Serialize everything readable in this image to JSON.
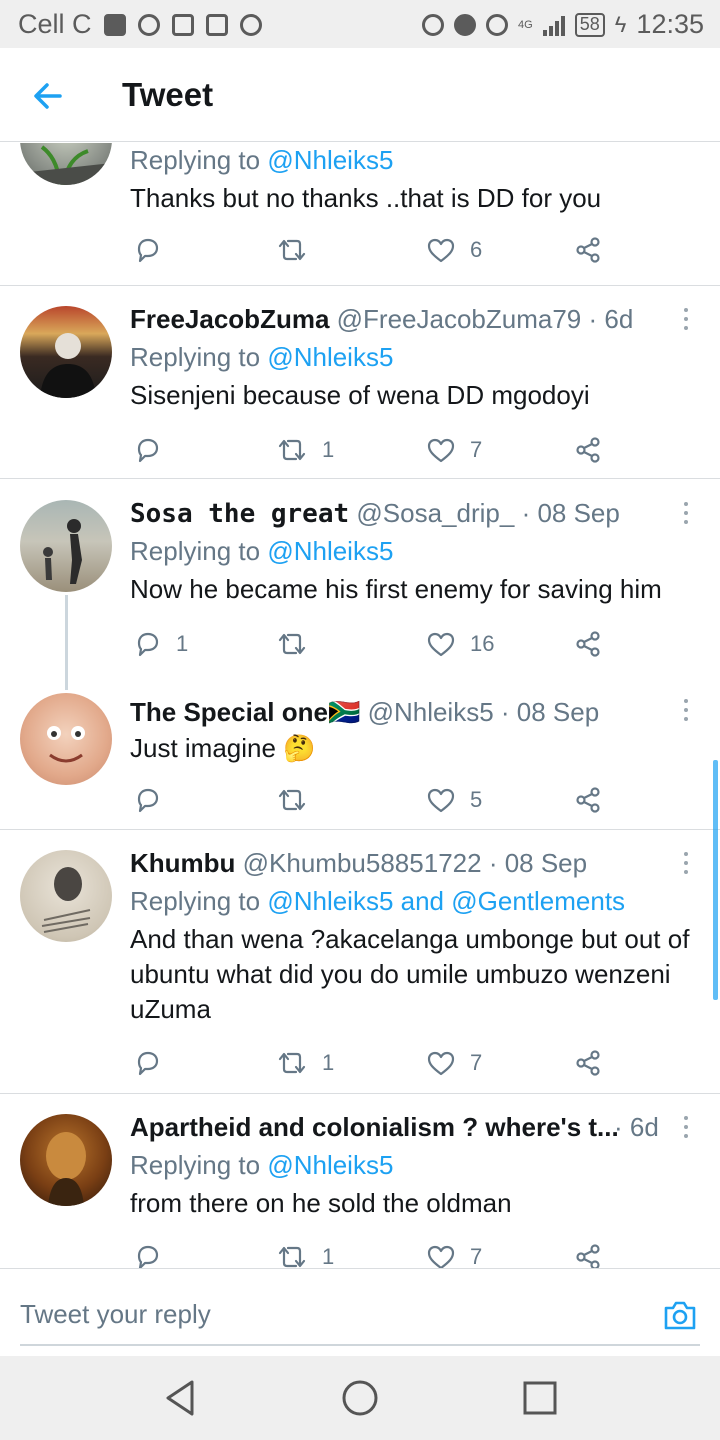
{
  "status_bar": {
    "carrier": "Cell C",
    "network": "4G",
    "battery": "58",
    "time": "12:35"
  },
  "header": {
    "title": "Tweet",
    "back_icon": "arrow-left-icon"
  },
  "colors": {
    "accent": "#1da1f2",
    "secondary_text": "#657786",
    "divider": "#dadde0"
  },
  "tweets": [
    {
      "name": "",
      "handle": "",
      "time": "",
      "reply_prefix": "Replying to ",
      "reply_to": "@Nhleiks5",
      "text": "Thanks but no thanks ..that is DD for you",
      "replies": "",
      "retweets": "",
      "likes": "6"
    },
    {
      "name": "FreeJacobZuma",
      "handle": "@FreeJacobZuma79",
      "time": "· 6d",
      "reply_prefix": "Replying to ",
      "reply_to": "@Nhleiks5",
      "text": "Sisenjeni because of wena DD mgodoyi",
      "replies": "",
      "retweets": "1",
      "likes": "7"
    },
    {
      "name": "Sosa the great",
      "handle": "@Sosa_drip_",
      "time": "· 08 Sep",
      "reply_prefix": "Replying to ",
      "reply_to": "@Nhleiks5",
      "text": "Now he became his first enemy for saving him",
      "replies": "1",
      "retweets": "",
      "likes": "16"
    },
    {
      "name": "The Special one🇿🇦",
      "handle": "@Nhleiks5",
      "time": "· 08 Sep",
      "text": "Just imagine 🤔",
      "replies": "",
      "retweets": "",
      "likes": "5"
    },
    {
      "name": "Khumbu",
      "handle": "@Khumbu58851722",
      "time": "· 08 Sep",
      "reply_prefix": "Replying to ",
      "reply_to": "@Nhleiks5 and @Gentlements",
      "text": "And than wena ?akacelanga umbonge but out of ubuntu what did you do umile umbuzo wenzeni uZuma",
      "replies": "",
      "retweets": "1",
      "likes": "7"
    },
    {
      "name": "Apartheid and colonialism ? where's t...",
      "handle": "",
      "time": "· 6d",
      "reply_prefix": "Replying to ",
      "reply_to": "@Nhleiks5",
      "text": "from there on he sold the oldman",
      "replies": "",
      "retweets": "1",
      "likes": "7"
    }
  ],
  "reply_box": {
    "placeholder": "Tweet your reply",
    "camera_icon": "camera-icon"
  },
  "nav_bar": {
    "back_icon": "nav-back-icon",
    "home_icon": "nav-home-icon",
    "recents_icon": "nav-recents-icon"
  }
}
